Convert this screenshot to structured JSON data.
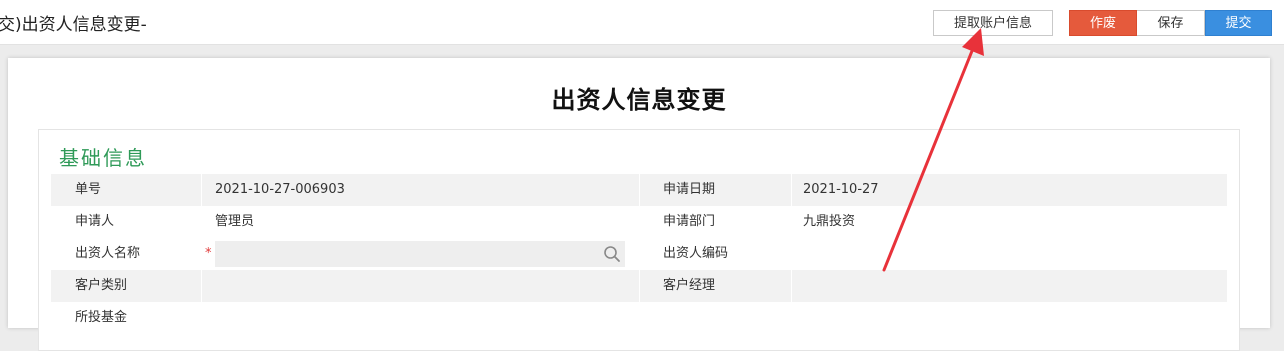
{
  "header": {
    "title": "交)出资人信息变更-",
    "buttons": {
      "fetch": "提取账户信息",
      "void": "作废",
      "save": "保存",
      "submit": "提交"
    }
  },
  "form": {
    "title": "出资人信息变更",
    "section_title": "基础信息",
    "fields": {
      "order_no_label": "单号",
      "order_no": "2021-10-27-006903",
      "apply_date_label": "申请日期",
      "apply_date": "2021-10-27",
      "applicant_label": "申请人",
      "applicant": "管理员",
      "dept_label": "申请部门",
      "dept": "九鼎投资",
      "investor_name_label": "出资人名称",
      "required_mark": "*",
      "investor_name": "",
      "investor_code_label": "出资人编码",
      "investor_code": "",
      "customer_type_label": "客户类别",
      "customer_type": "",
      "customer_manager_label": "客户经理",
      "customer_manager": "",
      "fund_label": "所投基金"
    }
  },
  "colors": {
    "void": "#e55a3c",
    "submit": "#3a8fe0",
    "section_title": "#2f9a58",
    "arrow": "#e8323a"
  },
  "icons": {
    "search": "search-icon"
  }
}
